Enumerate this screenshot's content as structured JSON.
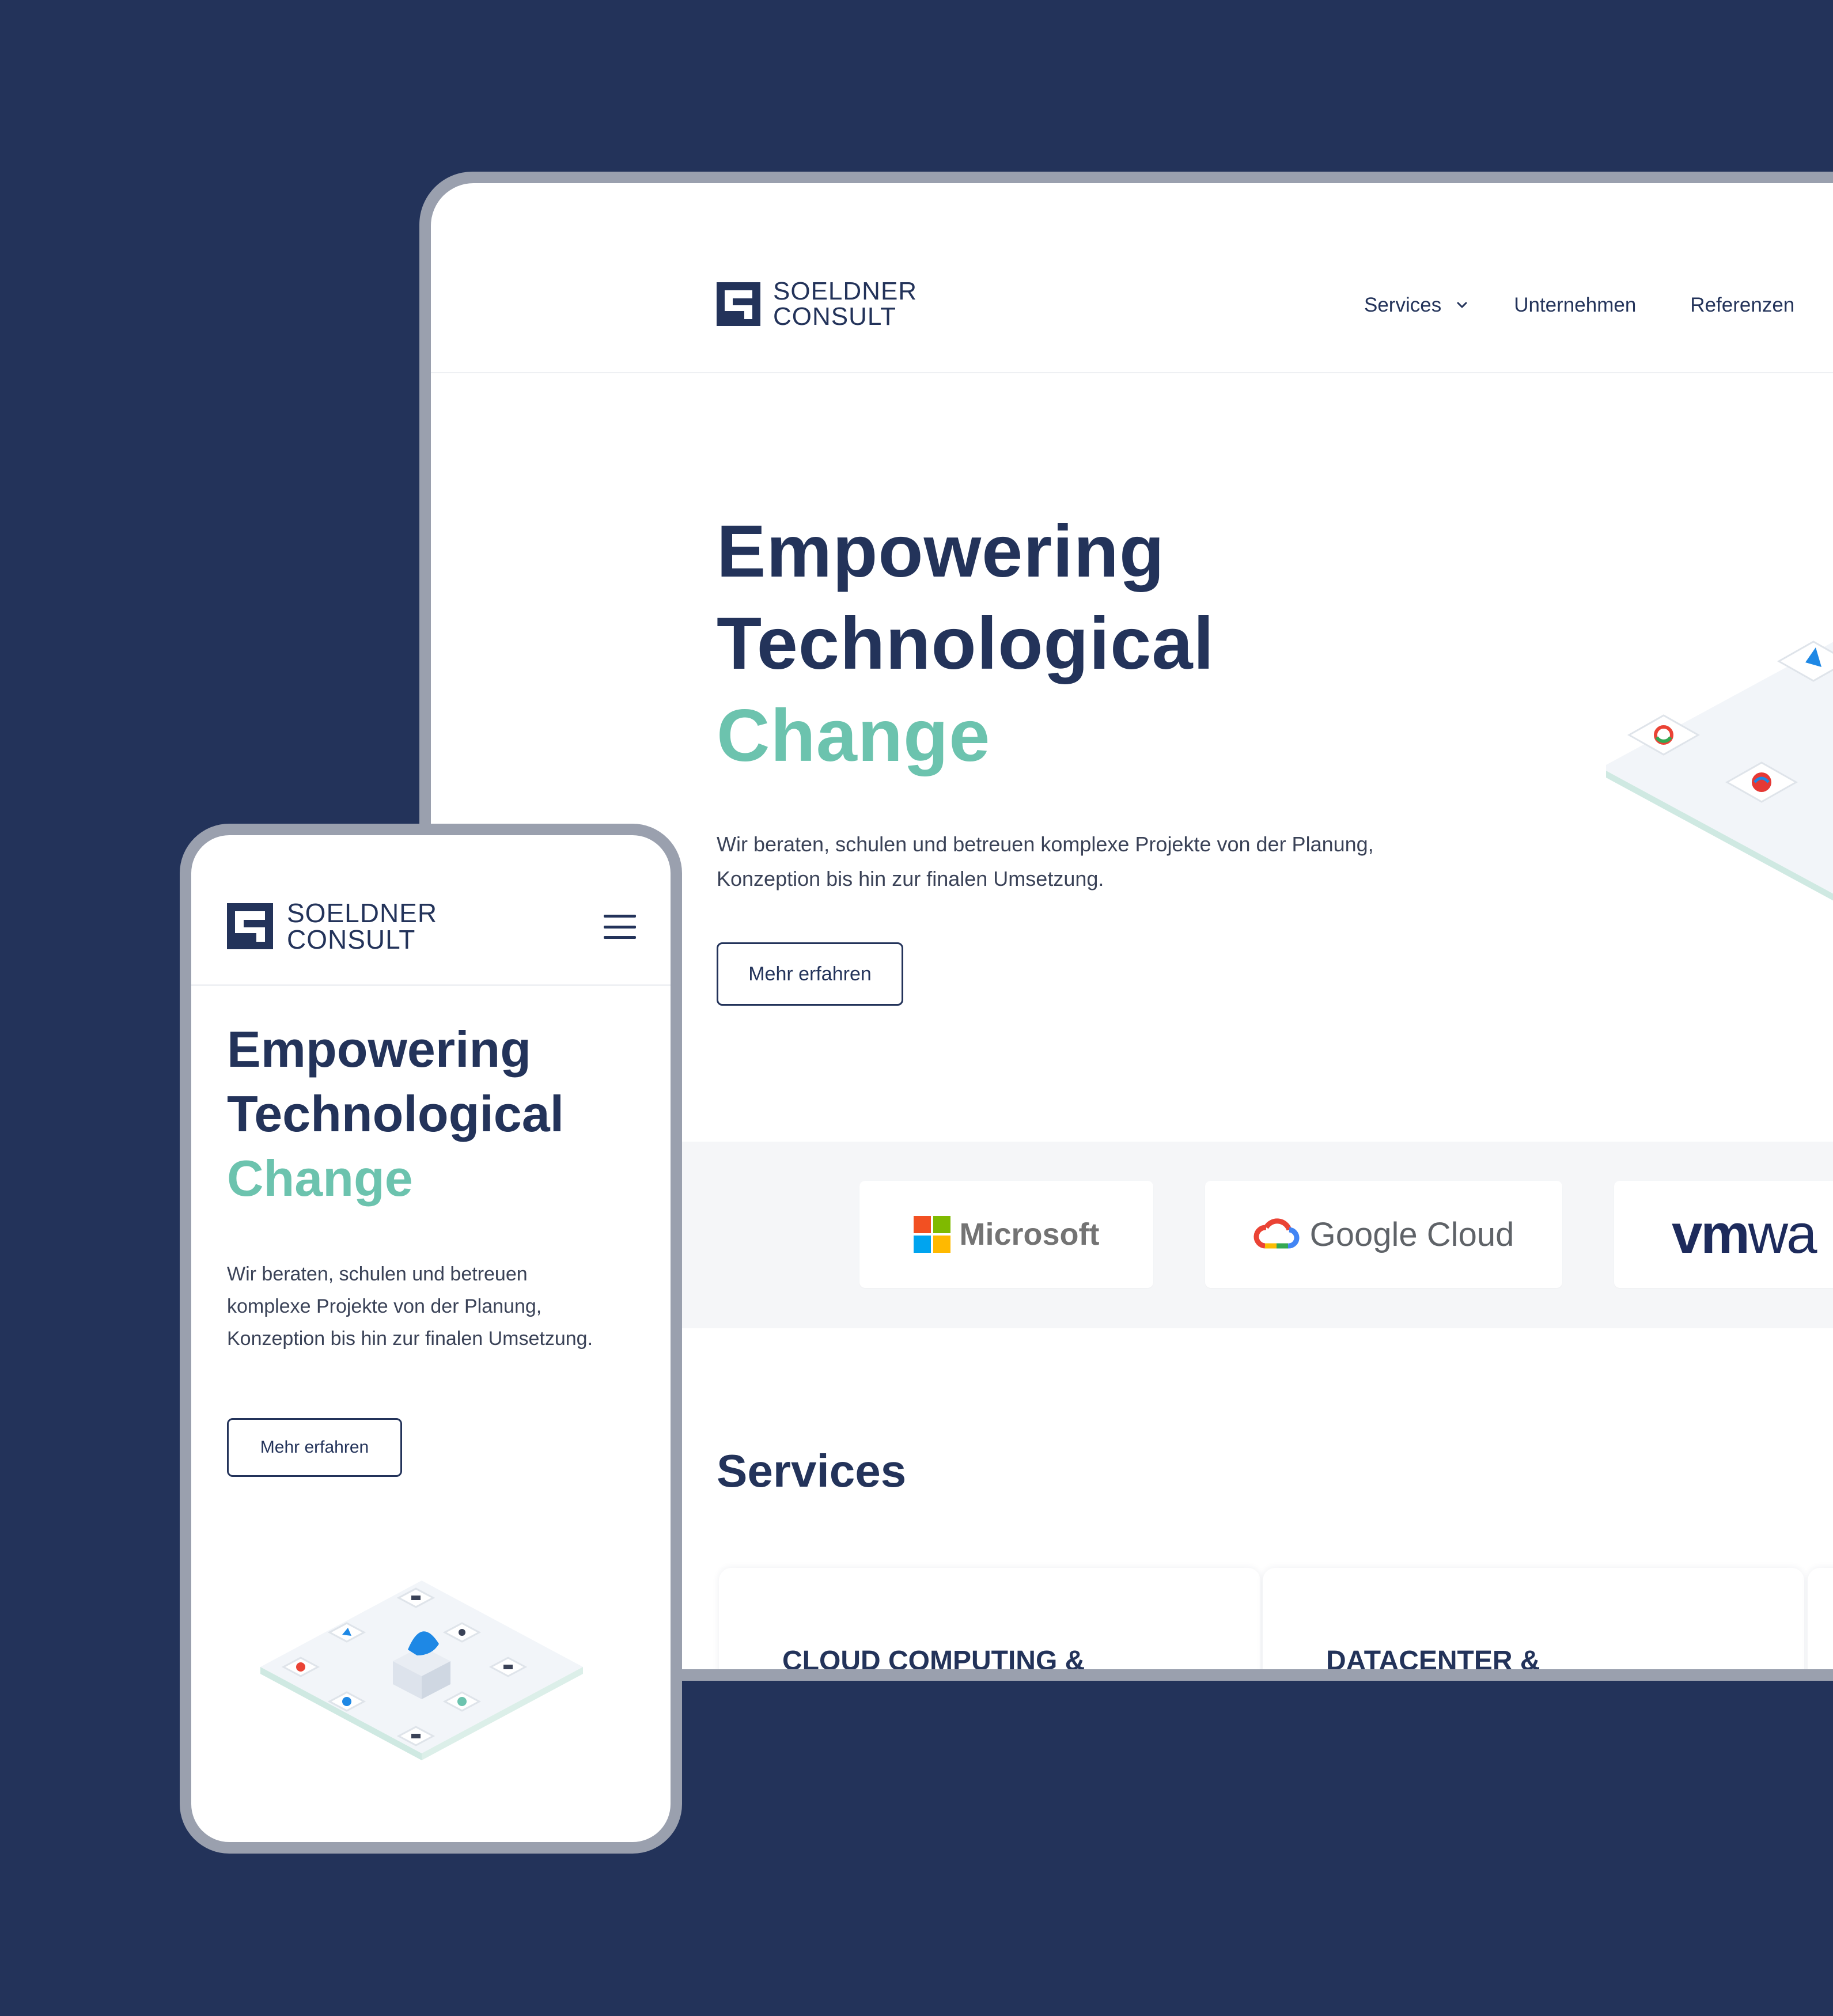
{
  "brand": {
    "line1": "SOELDNER",
    "line2": "CONSULT"
  },
  "desktop": {
    "nav": {
      "services": "Services",
      "unternehmen": "Unternehmen",
      "referenzen": "Referenzen"
    },
    "hero": {
      "title_line1": "Empowering",
      "title_line2": "Technological",
      "title_line3": "Change",
      "text": "Wir beraten, schulen und betreuen komplexe Projekte von der Planung, Konzeption bis hin zur finalen Umsetzung.",
      "button": "Mehr erfahren"
    },
    "partners": {
      "microsoft": "Microsoft",
      "google_cloud": "Google Cloud",
      "vmware_bold": "vm",
      "vmware_light": "wa"
    },
    "services": {
      "title": "Services",
      "card1": "CLOUD COMPUTING &",
      "card2": "DATACENTER &"
    }
  },
  "mobile": {
    "hero": {
      "title_line1": "Empowering",
      "title_line2": "Technological",
      "title_line3": "Change",
      "text": "Wir beraten, schulen und betreuen komplexe Projekte von der Planung, Konzeption bis hin zur finalen Umsetzung.",
      "button": "Mehr erfahren"
    }
  },
  "colors": {
    "background": "#23335a",
    "primary": "#23335a",
    "accent": "#6cc3ae",
    "frame": "#9aa0ae",
    "band": "#f5f6f8"
  },
  "icons": [
    "chevron-down-icon",
    "hamburger-menu-icon",
    "microsoft-logo-icon",
    "google-cloud-logo-icon"
  ]
}
